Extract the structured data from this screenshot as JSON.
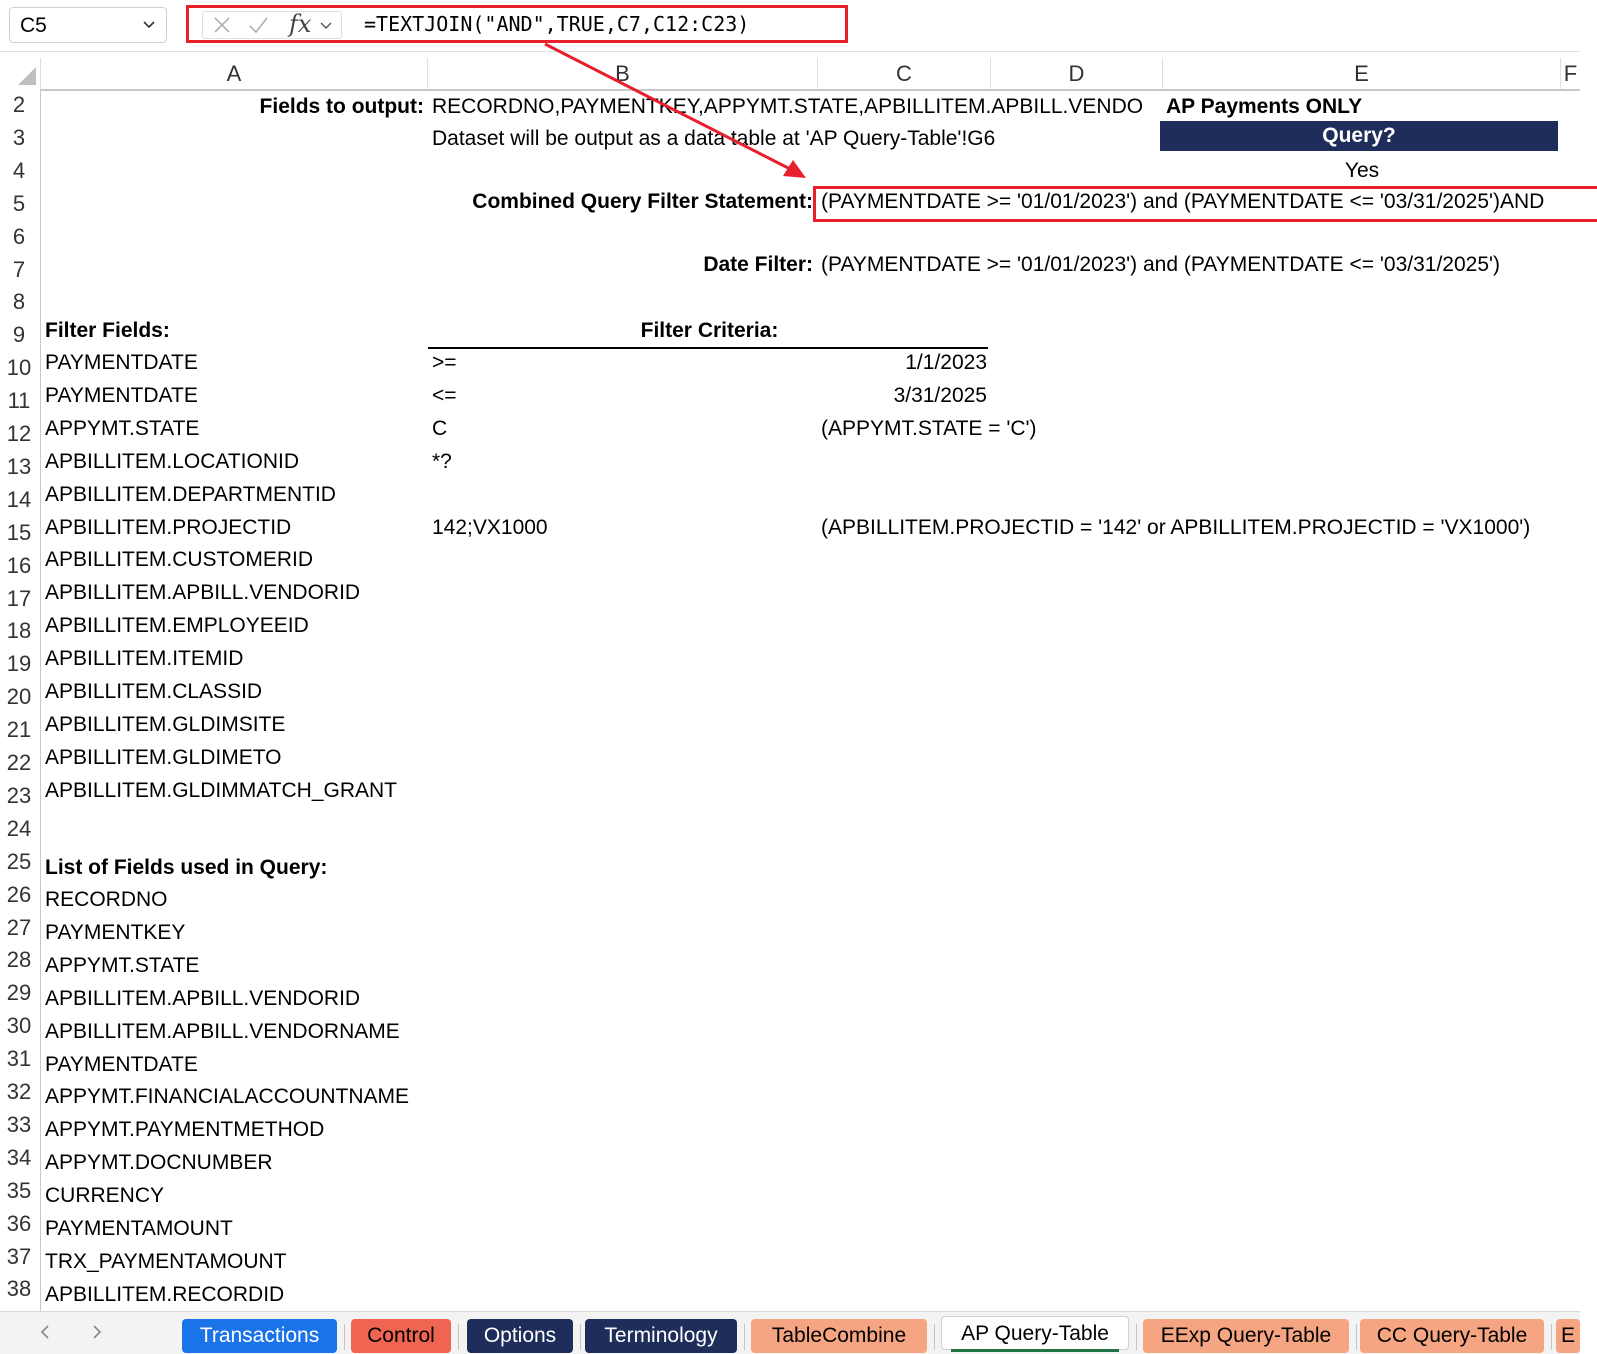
{
  "formula_bar": {
    "name_box": "C5",
    "fx_label": "fx",
    "formula": "=TEXTJOIN(\"AND\",TRUE,C7,C12:C23)"
  },
  "columns": [
    "A",
    "B",
    "C",
    "D",
    "E",
    "F"
  ],
  "rows": [
    "2",
    "3",
    "4",
    "5",
    "6",
    "7",
    "8",
    "9",
    "10",
    "11",
    "12",
    "13",
    "14",
    "15",
    "16",
    "17",
    "18",
    "19",
    "20",
    "21",
    "22",
    "23",
    "24",
    "25",
    "26",
    "27",
    "28",
    "29",
    "30",
    "31",
    "32",
    "33",
    "34",
    "35",
    "36",
    "37",
    "38"
  ],
  "cells": {
    "fields_to_output_label": "Fields to output:",
    "fields_to_output_value": "RECORDNO,PAYMENTKEY,APPYMT.STATE,APBILLITEM.APBILL.VENDO",
    "ap_payments_only": "AP Payments ONLY",
    "dataset_note": "Dataset will be output as a data table at 'AP Query-Table'!G6",
    "query_header": "Query?",
    "query_value": "Yes",
    "combined_label": "Combined Query Filter Statement:",
    "combined_value": "(PAYMENTDATE >= '01/01/2023') and (PAYMENTDATE <= '03/31/2025')AND",
    "date_filter_label": "Date Filter:",
    "date_filter_value": "(PAYMENTDATE >= '01/01/2023') and (PAYMENTDATE <= '03/31/2025')",
    "filter_fields_label": "Filter Fields:",
    "filter_criteria_label": "Filter Criteria:",
    "list_fields_label": "List of Fields used in Query:"
  },
  "filter_rows": [
    {
      "field": "PAYMENTDATE",
      "operator": ">=",
      "value": "1/1/2023",
      "clause": ""
    },
    {
      "field": "PAYMENTDATE",
      "operator": "<=",
      "value": "3/31/2025",
      "clause": ""
    },
    {
      "field": "APPYMT.STATE",
      "operator": "C",
      "value": "",
      "clause": "(APPYMT.STATE = 'C')"
    },
    {
      "field": "APBILLITEM.LOCATIONID",
      "operator": "*?",
      "value": "",
      "clause": ""
    },
    {
      "field": "APBILLITEM.DEPARTMENTID",
      "operator": "",
      "value": "",
      "clause": ""
    },
    {
      "field": "APBILLITEM.PROJECTID",
      "operator": "142;VX1000",
      "value": "",
      "clause": "(APBILLITEM.PROJECTID = '142' or APBILLITEM.PROJECTID = 'VX1000')"
    },
    {
      "field": "APBILLITEM.CUSTOMERID",
      "operator": "",
      "value": "",
      "clause": ""
    },
    {
      "field": "APBILLITEM.APBILL.VENDORID",
      "operator": "",
      "value": "",
      "clause": ""
    },
    {
      "field": "APBILLITEM.EMPLOYEEID",
      "operator": "",
      "value": "",
      "clause": ""
    },
    {
      "field": "APBILLITEM.ITEMID",
      "operator": "",
      "value": "",
      "clause": ""
    },
    {
      "field": "APBILLITEM.CLASSID",
      "operator": "",
      "value": "",
      "clause": ""
    },
    {
      "field": "APBILLITEM.GLDIMSITE",
      "operator": "",
      "value": "",
      "clause": ""
    },
    {
      "field": "APBILLITEM.GLDIMETO",
      "operator": "",
      "value": "",
      "clause": ""
    },
    {
      "field": "APBILLITEM.GLDIMMATCH_GRANT",
      "operator": "",
      "value": "",
      "clause": ""
    }
  ],
  "query_fields": [
    "RECORDNO",
    "PAYMENTKEY",
    "APPYMT.STATE",
    "APBILLITEM.APBILL.VENDORID",
    "APBILLITEM.APBILL.VENDORNAME",
    "PAYMENTDATE",
    "APPYMT.FINANCIALACCOUNTNAME",
    "APPYMT.PAYMENTMETHOD",
    "APPYMT.DOCNUMBER",
    "CURRENCY",
    "PAYMENTAMOUNT",
    "TRX_PAYMENTAMOUNT",
    "APBILLITEM.RECORDID"
  ],
  "tabs": [
    {
      "label": "Transactions",
      "bg": "#1a73e8",
      "fg": "#ffffff"
    },
    {
      "label": "Control",
      "bg": "#f06452",
      "fg": "#000000"
    },
    {
      "label": "Options",
      "bg": "#1f2d5a",
      "fg": "#ffffff"
    },
    {
      "label": "Terminology",
      "bg": "#1f2d5a",
      "fg": "#ffffff"
    },
    {
      "label": "TableCombine",
      "bg": "#f5a582",
      "fg": "#000000"
    },
    {
      "label": "AP Query-Table",
      "bg": "#ffffff",
      "fg": "#000000",
      "active": true
    },
    {
      "label": "EExp Query-Table",
      "bg": "#f5a582",
      "fg": "#000000"
    },
    {
      "label": "CC Query-Table",
      "bg": "#f5a582",
      "fg": "#000000"
    },
    {
      "label": "E",
      "bg": "#f5a582",
      "fg": "#000000"
    }
  ],
  "colors": {
    "highlight": "#e8202e",
    "query_header_bg": "#1f2d5a",
    "active_tab_underline": "#217346"
  }
}
